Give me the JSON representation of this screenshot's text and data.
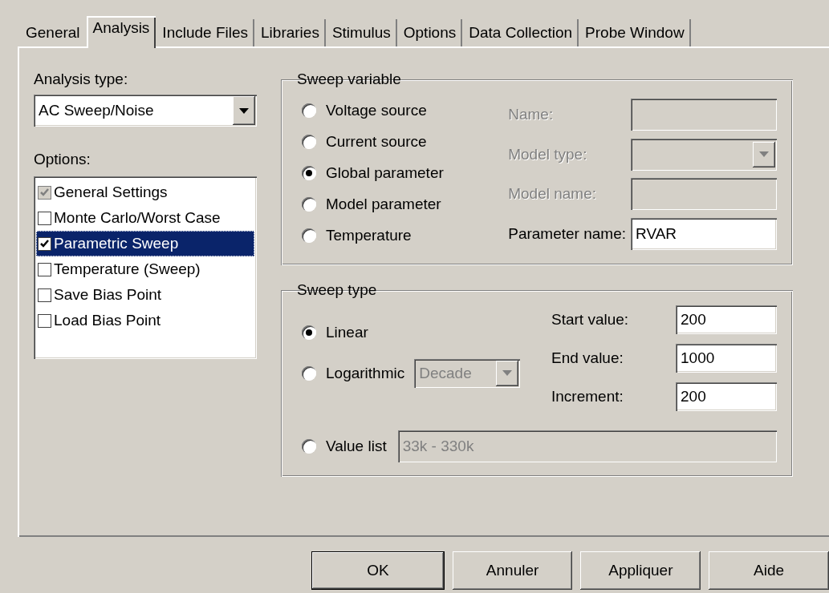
{
  "tabs": [
    {
      "label": "General",
      "selected": false
    },
    {
      "label": "Analysis",
      "selected": true
    },
    {
      "label": "Include Files",
      "selected": false
    },
    {
      "label": "Libraries",
      "selected": false
    },
    {
      "label": "Stimulus",
      "selected": false
    },
    {
      "label": "Options",
      "selected": false
    },
    {
      "label": "Data Collection",
      "selected": false
    },
    {
      "label": "Probe Window",
      "selected": false
    }
  ],
  "analysis_type": {
    "label": "Analysis type:",
    "value": "AC Sweep/Noise"
  },
  "options": {
    "label": "Options:",
    "items": [
      {
        "label": "General Settings",
        "checked": true,
        "disabled": true,
        "selected": false
      },
      {
        "label": "Monte Carlo/Worst Case",
        "checked": false,
        "disabled": false,
        "selected": false
      },
      {
        "label": "Parametric Sweep",
        "checked": true,
        "disabled": false,
        "selected": true
      },
      {
        "label": "Temperature (Sweep)",
        "checked": false,
        "disabled": false,
        "selected": false
      },
      {
        "label": "Save Bias Point",
        "checked": false,
        "disabled": false,
        "selected": false
      },
      {
        "label": "Load Bias Point",
        "checked": false,
        "disabled": false,
        "selected": false
      }
    ]
  },
  "sweep_variable": {
    "title": "Sweep variable",
    "radios": [
      {
        "label": "Voltage source",
        "selected": false
      },
      {
        "label": "Current source",
        "selected": false
      },
      {
        "label": "Global parameter",
        "selected": true
      },
      {
        "label": "Model parameter",
        "selected": false
      },
      {
        "label": "Temperature",
        "selected": false
      }
    ],
    "fields": [
      {
        "label": "Name:",
        "kind": "text",
        "disabled": true
      },
      {
        "label": "Model type:",
        "kind": "dropdown",
        "disabled": true
      },
      {
        "label": "Model name:",
        "kind": "text",
        "disabled": true
      },
      {
        "label": "Parameter name:",
        "kind": "text",
        "disabled": false,
        "value": "RVAR"
      }
    ]
  },
  "sweep_type": {
    "title": "Sweep type",
    "radios": [
      {
        "label": "Linear",
        "selected": true
      },
      {
        "label": "Logarithmic",
        "selected": false
      },
      {
        "label": "Value list",
        "selected": false
      }
    ],
    "logarithmic_dropdown": {
      "value": "Decade",
      "disabled": true
    },
    "value_list": {
      "value": "33k - 330k",
      "disabled": true
    },
    "fields": [
      {
        "label": "Start value:",
        "value": "200"
      },
      {
        "label": "End value:",
        "value": "1000"
      },
      {
        "label": "Increment:",
        "value": "200"
      }
    ]
  },
  "buttons": [
    {
      "label": "OK",
      "default": true
    },
    {
      "label": "Annuler",
      "default": false
    },
    {
      "label": "Appliquer",
      "default": false
    },
    {
      "label": "Aide",
      "default": false
    }
  ]
}
